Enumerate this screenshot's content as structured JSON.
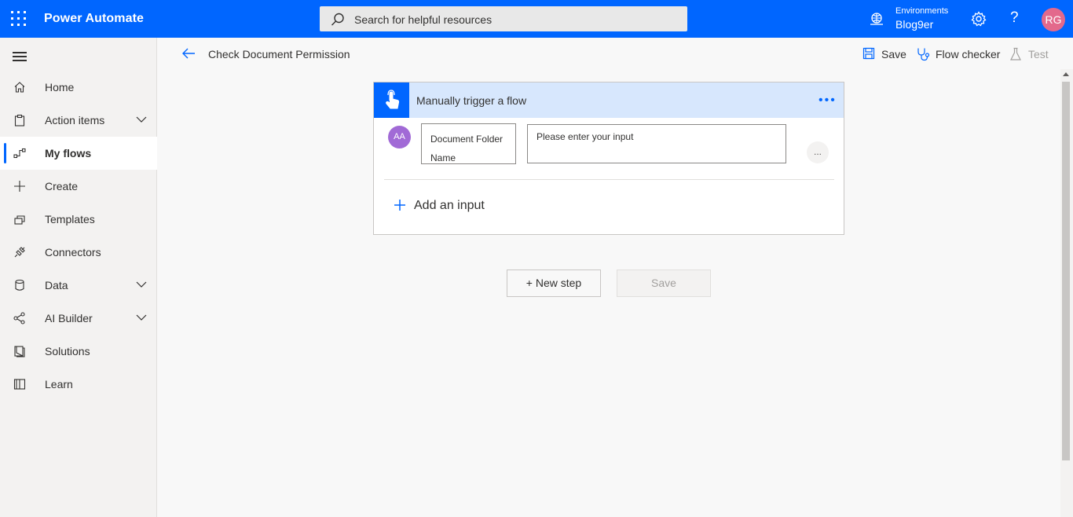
{
  "app": {
    "name": "Power Automate"
  },
  "search": {
    "placeholder": "Search for helpful resources"
  },
  "environment": {
    "label": "Environments",
    "name": "Blog9er"
  },
  "user": {
    "initials": "RG"
  },
  "colors": {
    "brand": "#0066ff",
    "card_header": "#d7e7fd",
    "avatar": "#e3698c",
    "input_avatar": "#a16ad6"
  },
  "sidebar": {
    "items": [
      {
        "label": "Home",
        "icon": "home-icon"
      },
      {
        "label": "Action items",
        "icon": "clipboard-icon"
      },
      {
        "label": "My flows",
        "icon": "flow-icon"
      },
      {
        "label": "Create",
        "icon": "plus-icon"
      },
      {
        "label": "Templates",
        "icon": "templates-icon"
      },
      {
        "label": "Connectors",
        "icon": "connector-icon"
      },
      {
        "label": "Data",
        "icon": "database-icon"
      },
      {
        "label": "AI Builder",
        "icon": "ai-builder-icon"
      },
      {
        "label": "Solutions",
        "icon": "solutions-icon"
      },
      {
        "label": "Learn",
        "icon": "book-icon"
      }
    ]
  },
  "header": {
    "flow_title": "Check Document Permission",
    "save_label": "Save",
    "flow_checker_label": "Flow checker",
    "test_label": "Test"
  },
  "trigger": {
    "title": "Manually trigger a flow",
    "input_avatar": "AA",
    "field_name_line1": "Document Folder",
    "field_name_line2": "Name",
    "field_value_placeholder": "Please enter your input",
    "more_options": "...",
    "add_input_label": "Add an input"
  },
  "actions": {
    "new_step_label": "+ New step",
    "save_label": "Save"
  }
}
